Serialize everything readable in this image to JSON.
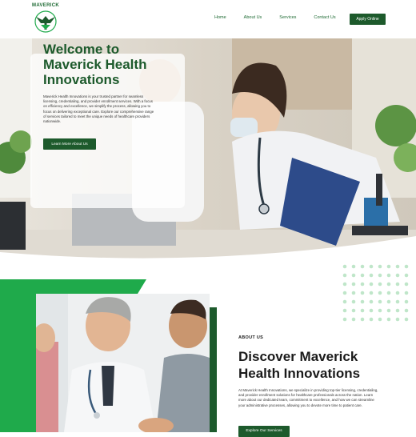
{
  "brand": {
    "logo_text": "MAVERICK"
  },
  "nav": {
    "links": [
      "Home",
      "About Us",
      "Services",
      "Contact Us"
    ],
    "cta_label": "Apply Online"
  },
  "hero": {
    "title": "Welcome to Maverick Health Innovations",
    "text": "Maverick Health Innovations is your trusted partner for seamless licensing, credentialing, and provider enrollment services. With a focus on efficiency and excellence, we simplify the process, allowing you to focus on delivering exceptional care. Explore our comprehensive range of services tailored to meet the unique needs of healthcare providers nationwide.",
    "button_label": "Learn More About Us"
  },
  "about": {
    "label": "ABOUT US",
    "title": "Discover Maverick Health Innovations",
    "text": "At Maverick Health Innovations, we specialize in providing top-tier licensing, credentialing, and provider enrollment solutions for healthcare professionals across the nation. Learn more about our dedicated team, commitment to excellence, and how we can streamline your administrative processes, allowing you to devote more time to patient care.",
    "button_label": "Explore Our Services"
  },
  "colors": {
    "brand_dark": "#1d5a2c",
    "brand_bright": "#1faa4b",
    "dot": "#bfe6c9"
  },
  "icons": [
    "logo-emblem-icon"
  ]
}
